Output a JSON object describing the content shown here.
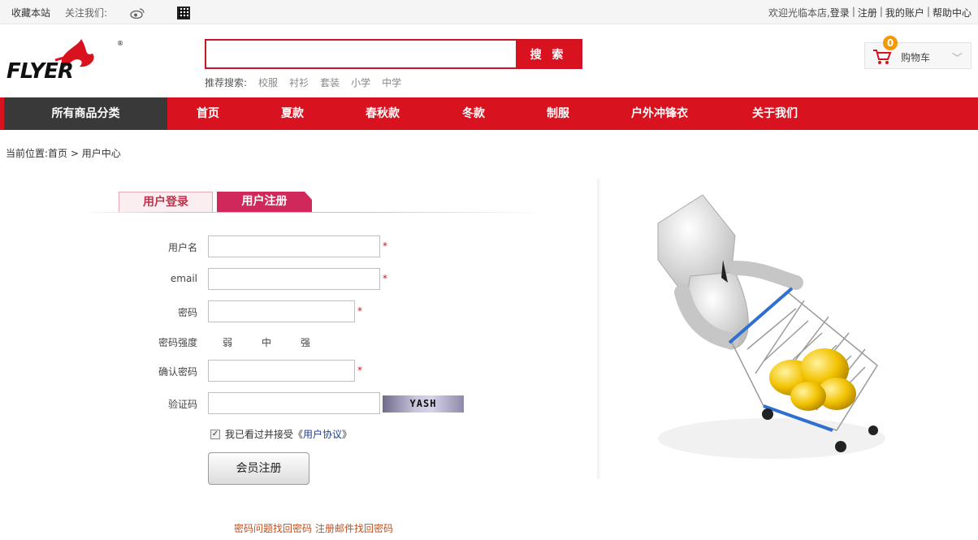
{
  "topbar": {
    "favorite": "收藏本站",
    "follow": "关注我们:",
    "welcome": "欢迎光临本店,",
    "links": [
      "登录",
      "注册",
      "我的账户",
      "帮助中心"
    ]
  },
  "header": {
    "search_button": "搜 索",
    "search_placeholder": "",
    "hot_label": "推荐搜索:",
    "hot_terms": [
      "校服",
      "衬衫",
      "套装",
      "小学",
      "中学"
    ],
    "cart_label": "购物车",
    "cart_count": "0"
  },
  "nav": {
    "all_categories": "所有商品分类",
    "items": [
      "首页",
      "夏款",
      "春秋款",
      "冬款",
      "制服",
      "户外冲锋衣",
      "关于我们"
    ]
  },
  "breadcrumb": {
    "prefix": "当前位置:",
    "home": "首页",
    "current": "用户中心"
  },
  "tabs": {
    "login": "用户登录",
    "register": "用户注册"
  },
  "form": {
    "username_label": "用户名",
    "email_label": "email",
    "password_label": "密码",
    "strength_label": "密码强度",
    "strength_levels": [
      "弱",
      "中",
      "强"
    ],
    "confirm_label": "确认密码",
    "captcha_label": "验证码",
    "captcha_text": "YASH",
    "required_mark": "*",
    "agree_text": "我已看过并接受《",
    "agree_link": "用户协议",
    "agree_close": "》",
    "submit": "会员注册",
    "recover_question": "密码问题找回密码",
    "recover_email": "注册邮件找回密码"
  },
  "colors": {
    "brand_red": "#d9121f",
    "nav_dark": "#393939",
    "tab_active": "#d0285a"
  }
}
